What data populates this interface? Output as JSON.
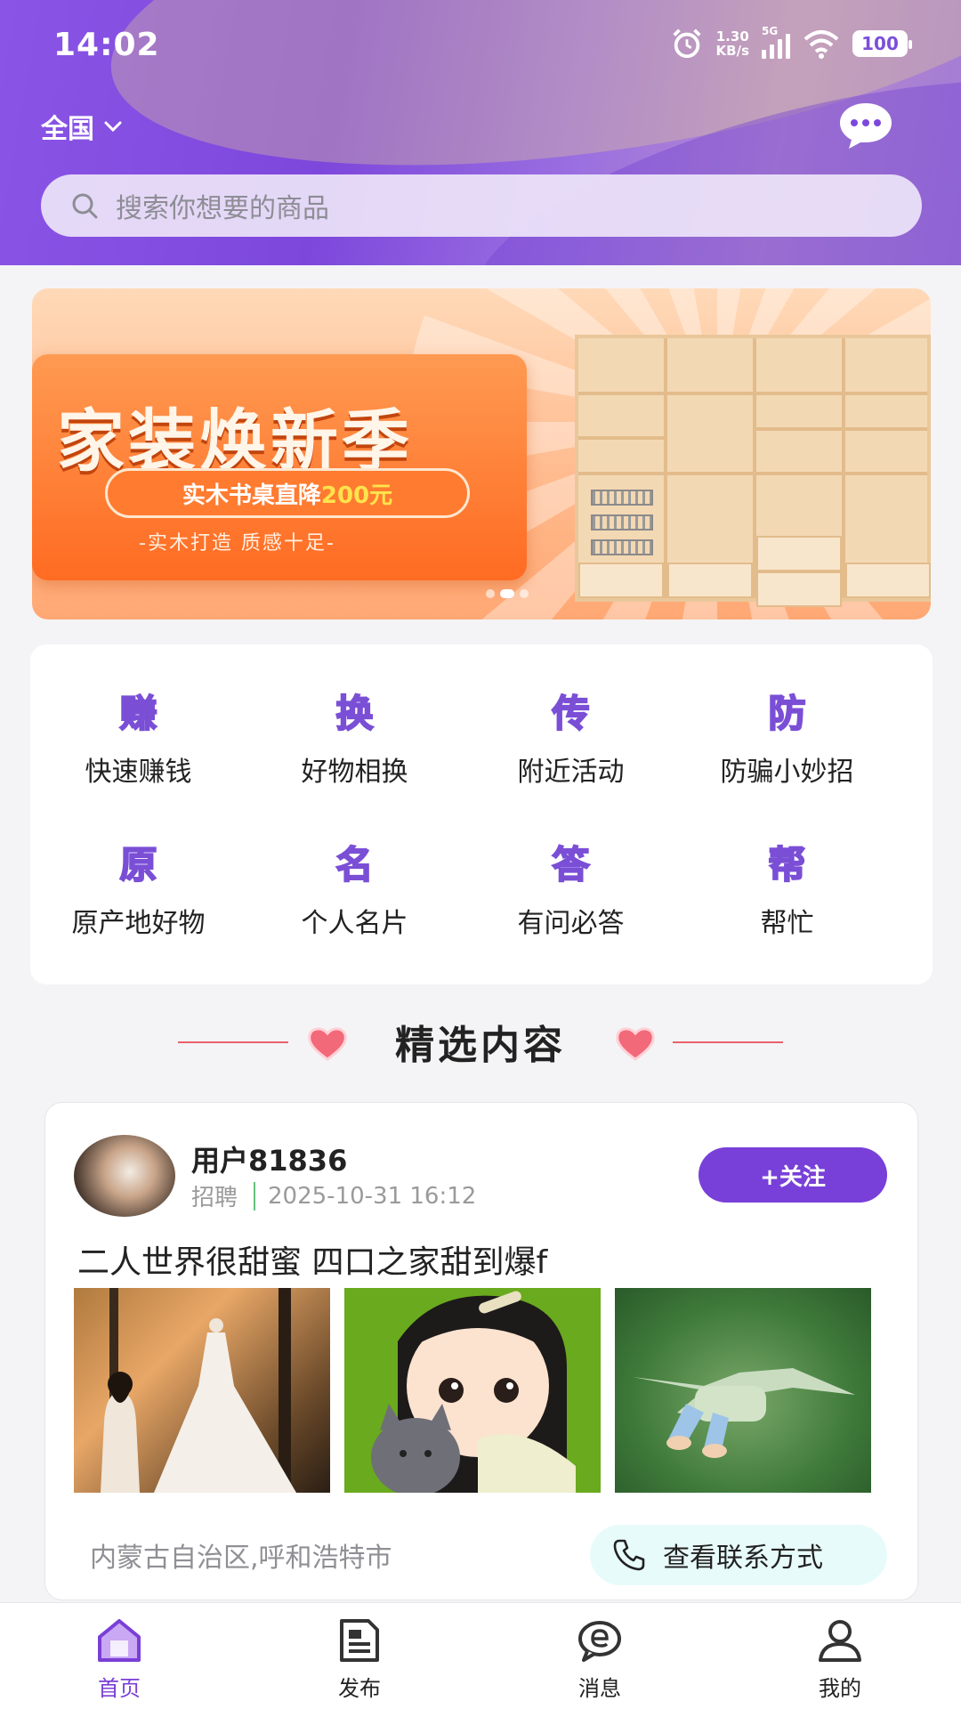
{
  "status": {
    "time": "14:02",
    "net_speed_value": "1.30",
    "net_speed_unit": "KB/s",
    "signal": "5G",
    "battery": "100"
  },
  "header": {
    "region": "全国",
    "search_placeholder": "搜索你想要的商品"
  },
  "banner": {
    "headline": "家装焕新季",
    "pill_prefix": "实木书桌直降",
    "pill_amount": "200元",
    "subline": "-实木打造 质感十足-",
    "active_dot": 1
  },
  "categories": [
    {
      "glyph": "赚",
      "label": "快速赚钱"
    },
    {
      "glyph": "换",
      "label": "好物相换"
    },
    {
      "glyph": "传",
      "label": "附近活动"
    },
    {
      "glyph": "防",
      "label": "防骗小妙招"
    },
    {
      "glyph": "原",
      "label": "原产地好物"
    },
    {
      "glyph": "名",
      "label": "个人名片"
    },
    {
      "glyph": "答",
      "label": "有问必答"
    },
    {
      "glyph": "帮",
      "label": "帮忙"
    }
  ],
  "section": {
    "title": "精选内容"
  },
  "post": {
    "username": "用户81836",
    "category": "招聘",
    "datetime": "2025-10-31 16:12",
    "follow_label": "+关注",
    "title": "二人世界很甜蜜 四口之家甜到爆f",
    "location": "内蒙古自治区,呼和浩特市",
    "contact_label": "查看联系方式"
  },
  "tabs": [
    {
      "label": "首页",
      "icon": "home-icon",
      "active": true
    },
    {
      "label": "发布",
      "icon": "publish-icon",
      "active": false
    },
    {
      "label": "消息",
      "icon": "message-icon",
      "active": false
    },
    {
      "label": "我的",
      "icon": "profile-icon",
      "active": false
    }
  ],
  "colors": {
    "brand": "#7840d8",
    "accent_heart": "#e8616a"
  }
}
